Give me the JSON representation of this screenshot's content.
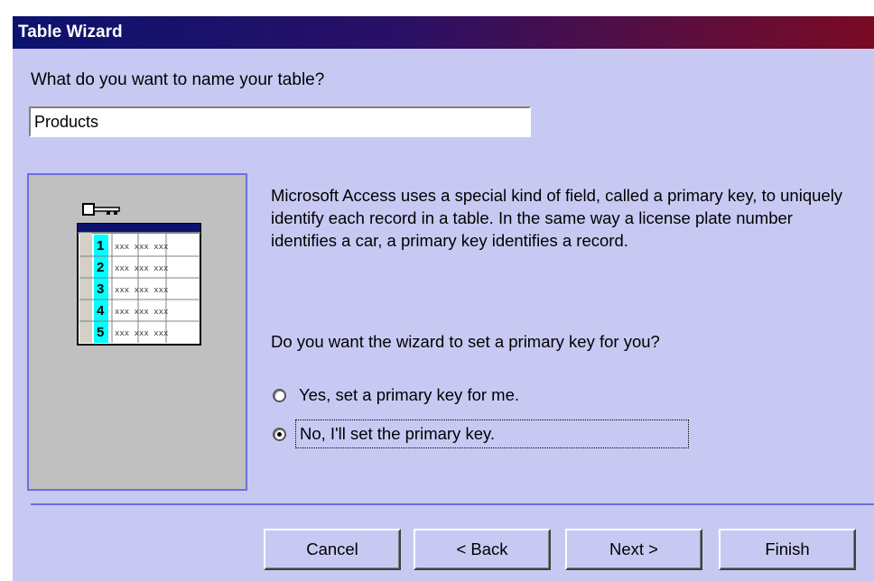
{
  "window": {
    "title": "Table Wizard"
  },
  "name_prompt": {
    "label": "What do you want to name your table?",
    "value": "Products"
  },
  "illustration": {
    "row_numbers": [
      "1",
      "2",
      "3",
      "4",
      "5"
    ],
    "cell_text": "xxx xxx xxx",
    "key_icon": "key-icon"
  },
  "description": "Microsoft Access uses a special kind of field, called a primary key, to uniquely identify each record in a table. In the same way a license plate number identifies a car, a primary key identifies a record.",
  "primary_key_question": "Do you want the wizard to set a primary key for you?",
  "options": {
    "yes_label": "Yes, set a primary key for me.",
    "no_label": "No, I'll set the primary key.",
    "selected": "no"
  },
  "buttons": {
    "cancel": "Cancel",
    "back": "< Back",
    "next": "Next >",
    "finish": "Finish"
  },
  "colors": {
    "dialog_background": "#c8c9f3",
    "title_gradient_start": "#0b126e",
    "title_gradient_end": "#7a0a24",
    "accent_line": "#6b6fe0",
    "key_column": "#00ffff"
  }
}
